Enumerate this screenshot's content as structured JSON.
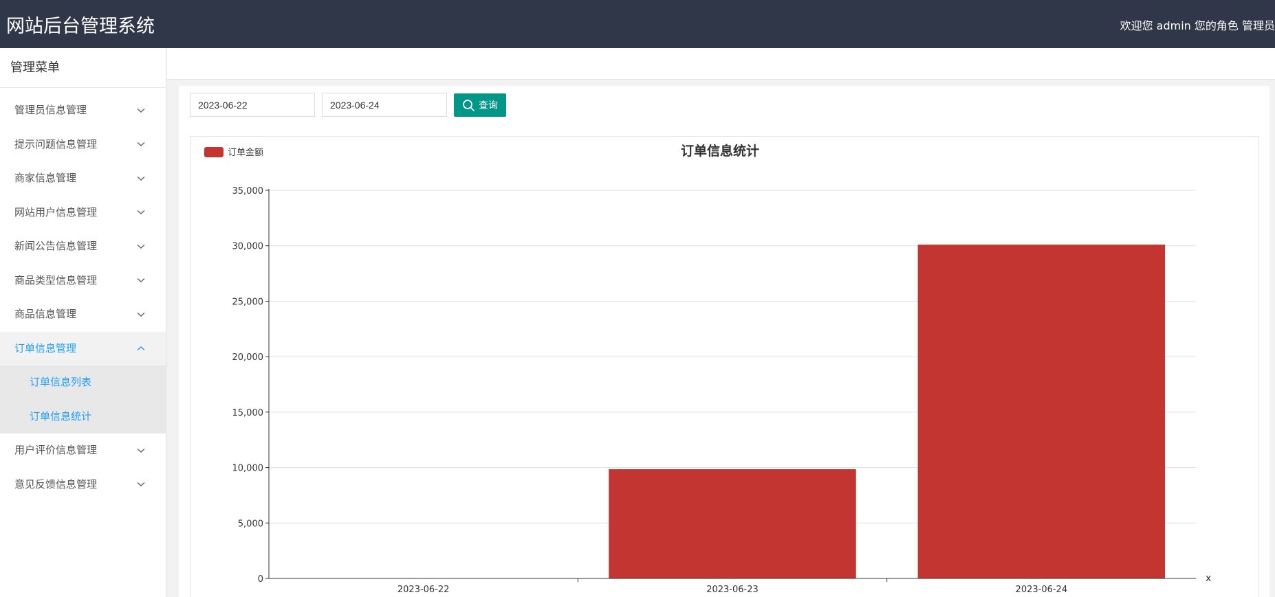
{
  "header": {
    "title": "网站后台管理系统",
    "welcome": "欢迎您 admin 您的角色 管理员"
  },
  "sidebar": {
    "title": "管理菜单",
    "items": [
      {
        "label": "管理员信息管理"
      },
      {
        "label": "提示问题信息管理"
      },
      {
        "label": "商家信息管理"
      },
      {
        "label": "网站用户信息管理"
      },
      {
        "label": "新闻公告信息管理"
      },
      {
        "label": "商品类型信息管理"
      },
      {
        "label": "商品信息管理"
      },
      {
        "label": "订单信息管理",
        "open": true,
        "children": [
          {
            "label": "订单信息列表"
          },
          {
            "label": "订单信息统计"
          }
        ]
      },
      {
        "label": "用户评价信息管理"
      },
      {
        "label": "意见反馈信息管理"
      }
    ]
  },
  "filters": {
    "start_date": "2023-06-22",
    "end_date": "2023-06-24",
    "search_label": "查询"
  },
  "colors": {
    "header_bg": "#2f3749",
    "accent_blue": "#1e9fff",
    "button_teal": "#009688",
    "bar_red": "#c23531"
  },
  "icons": {
    "search_button": "search-icon",
    "menu_collapsed": "chevron-down-icon",
    "menu_expanded": "chevron-up-icon"
  },
  "chart_data": {
    "type": "bar",
    "title": "订单信息统计",
    "categories": [
      "2023-06-22",
      "2023-06-23",
      "2023-06-24"
    ],
    "series": [
      {
        "name": "订单金额",
        "values": [
          0,
          9850,
          30100
        ],
        "color": "#c23531"
      }
    ],
    "ylim": [
      0,
      35000
    ],
    "yticks": [
      "0",
      "5,000",
      "10,000",
      "15,000",
      "20,000",
      "25,000",
      "30,000",
      "35,000"
    ],
    "xlabel": "x",
    "ylabel": "",
    "grid": true,
    "legend_position": "top-left"
  }
}
